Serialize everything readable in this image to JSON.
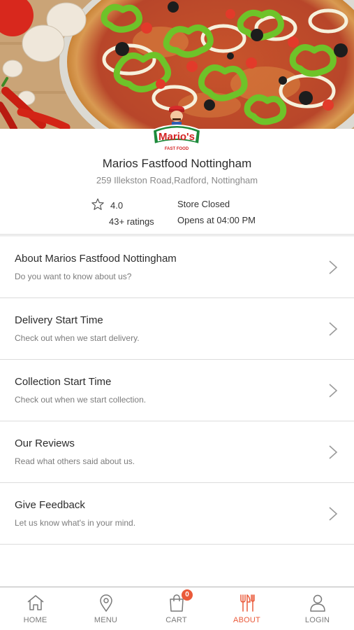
{
  "theme": {
    "accent": "#ea5a3a",
    "text_primary": "#2c2c2c",
    "text_secondary": "#7c7c7c",
    "divider": "#dcdcdc"
  },
  "hero": {
    "image": "pizza-banner"
  },
  "logo": {
    "brand_text": "Mario's",
    "tagline": "FAST FOOD",
    "icon": "mario-mascot-logo"
  },
  "store": {
    "name": "Marios Fastfood Nottingham",
    "address": "259 Illekston Road,Radford, Nottingham",
    "rating": "4.0",
    "rating_count": "43+ ratings",
    "status": "Store Closed",
    "opens_at": "Opens at 04:00 PM"
  },
  "menu": {
    "items": [
      {
        "title": "About Marios Fastfood Nottingham",
        "subtitle": "Do you want to know about us?"
      },
      {
        "title": "Delivery Start Time",
        "subtitle": "Check out when we start delivery."
      },
      {
        "title": "Collection Start Time",
        "subtitle": "Check out when we start collection."
      },
      {
        "title": "Our Reviews",
        "subtitle": "Read what others said about us."
      },
      {
        "title": "Give Feedback",
        "subtitle": "Let us know what's in your mind."
      }
    ]
  },
  "nav": {
    "items": [
      {
        "label": "HOME",
        "icon": "home-icon"
      },
      {
        "label": "MENU",
        "icon": "location-pin-icon"
      },
      {
        "label": "CART",
        "icon": "shopping-bag-icon",
        "badge": "0"
      },
      {
        "label": "ABOUT",
        "icon": "fork-knife-icon",
        "active": true
      },
      {
        "label": "LOGIN",
        "icon": "user-icon"
      }
    ]
  }
}
